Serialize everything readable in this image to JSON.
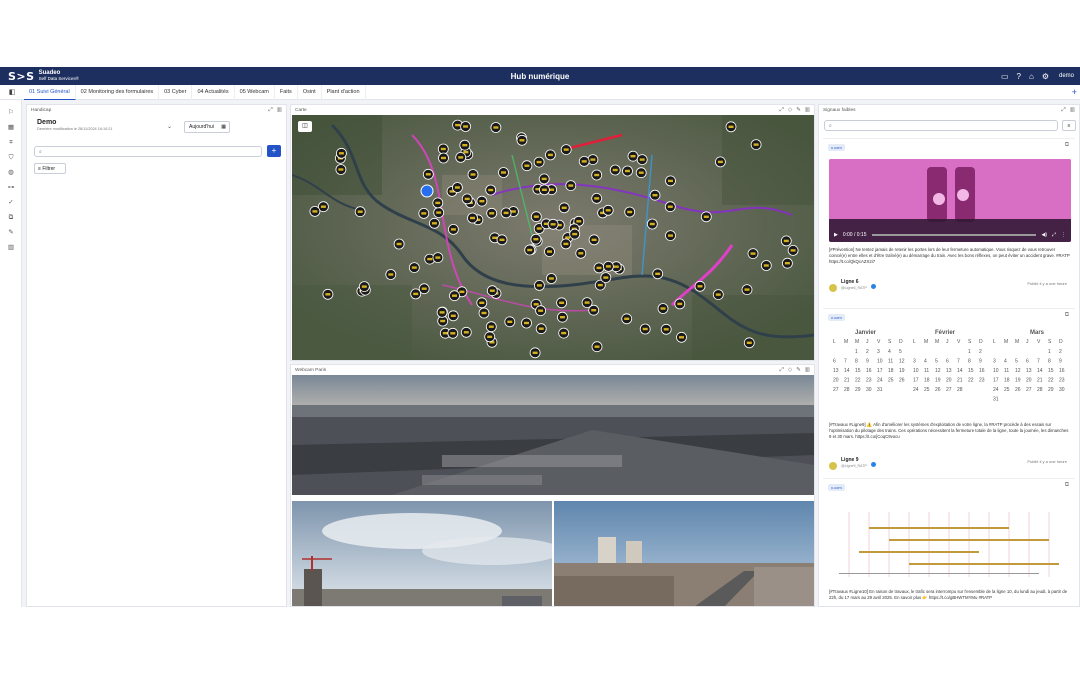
{
  "header": {
    "logo_mark": "S>S",
    "logo_line1": "Suadeo",
    "logo_line2": "Self Data Services®",
    "title": "Hub numérique",
    "user": "demo"
  },
  "tabs": [
    {
      "label": "01 Suivi Général"
    },
    {
      "label": "02 Monitoring des formulaires"
    },
    {
      "label": "03 Cyber"
    },
    {
      "label": "04 Actualités"
    },
    {
      "label": "05 Webcam"
    },
    {
      "label": "Faits"
    },
    {
      "label": "Osint"
    },
    {
      "label": "Plant d'action"
    }
  ],
  "left_panel": {
    "title": "Handicap",
    "name": "Demo",
    "subtitle": "Dernière modification le 28/11/2024 16:10:21",
    "today_button": "Aujourd'hui",
    "search_placeholder": "",
    "filter_label": "Filtrer"
  },
  "map_panel": {
    "title": "Carte"
  },
  "webcam_panel": {
    "title": "Webcam Paris"
  },
  "news_panel": {
    "title": "Signaux faibles",
    "search_placeholder": "",
    "cards": [
      {
        "source": "x.com",
        "video_time": "0:00 / 0:15",
        "text": "[#Prévention] Ne tentez jamais de retenir les portes lors de leur fermeture automatique. Vous risquez de vous retrouver coincé(e) entre elles et d'être traîné(e) au démarrage du train. Avec les bons réflexes, on peut éviter un accident grave. #RATP https://t.co/QkQcAZX2i7",
        "author": "Ligne 6",
        "handle": "@Ligne6_RATP",
        "posted": "Publié il y a une heure"
      },
      {
        "source": "x.com",
        "months": [
          "Janvier",
          "Février",
          "Mars"
        ],
        "text": "[#Travaux #Ligne9] ⚠️ Afin d'améliorer les systèmes d'exploitation de votre ligne, la #RATP procède à des essais sur l'optimisation du pilotage des trains. Ces opérations nécessitent la fermeture totale de la ligne, toute la journée, les dimanches 9 et 30 mars. https://t.co/jCoqC9vocu",
        "author": "Ligne 9",
        "handle": "@Ligne9_RATP",
        "posted": "Publié il y a une heure"
      },
      {
        "source": "x.com",
        "text": "[#Travaux #Ligne10] En raison de travaux, le trafic sera interrompu sur l'ensemble de la ligne 10, du lundi au jeudi, à partir de 22h, du 17 mars au 29 avril 2025. En savoir plus 👉 https://t.co/gBHWTMYMu #RATP"
      }
    ]
  },
  "colors": {
    "header_bg": "#1d2f5e",
    "accent": "#2453c7",
    "marker": "#1a1a1a",
    "marker_ring": "#d4b020",
    "route_magenta": "#e040c8",
    "route_purple": "#8a2ad0",
    "route_red": "#e0203a",
    "video_bg": "#d86fc4"
  },
  "icons": [
    "sidebar-toggle-icon",
    "chat-icon",
    "help-icon",
    "home-icon",
    "gear-icon",
    "search-icon",
    "plus-icon",
    "filter-icon",
    "calendar-icon",
    "expand-icon",
    "fullscreen-icon",
    "delete-icon",
    "external-link-icon",
    "play-icon",
    "volume-icon"
  ]
}
